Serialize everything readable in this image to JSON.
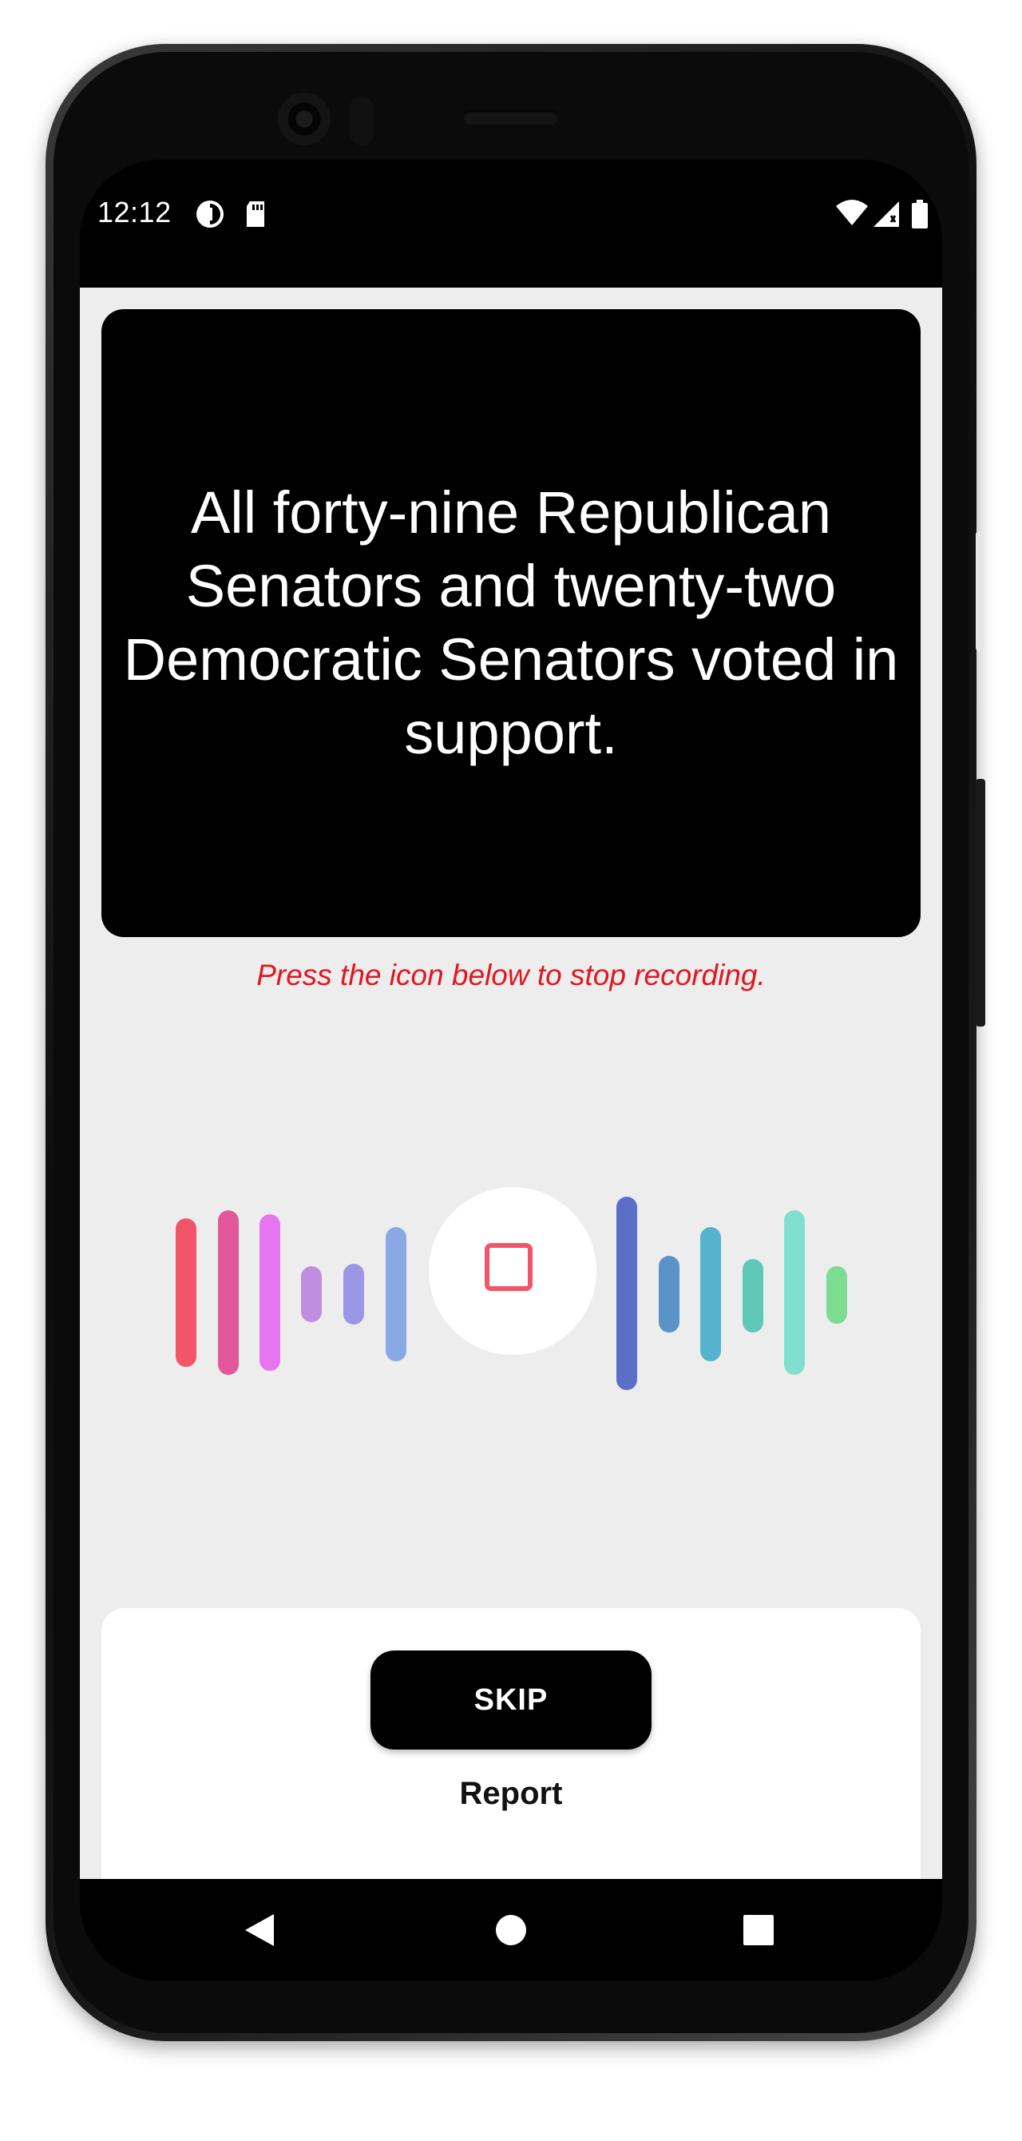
{
  "status_bar": {
    "time": "12:12",
    "icons_left": [
      "data-saver-icon",
      "sd-card-icon"
    ],
    "icons_right": [
      "wifi-icon",
      "cell-signal-icon",
      "battery-icon"
    ]
  },
  "prompt": {
    "sentence": "All forty-nine Republican Senators and twenty-two Democratic Senators voted in support."
  },
  "instruction": {
    "text": "Press the icon below to stop recording.",
    "color": "#e2161f"
  },
  "recorder": {
    "icon": "stop-icon",
    "state": "recording",
    "wave_colors_left": [
      "#f25568",
      "#e2589a",
      "#e576f0",
      "#bf8ee0",
      "#9b96e6",
      "#8aa8e4"
    ],
    "wave_colors_right": [
      "#5a6fc8",
      "#5a93c8",
      "#55b3cf",
      "#5fc9b5",
      "#7fe0cf",
      "#7bdc92"
    ]
  },
  "actions": {
    "skip_label": "SKIP",
    "report_label": "Report"
  },
  "nav": {
    "icons": [
      "back-icon",
      "home-icon",
      "recents-icon"
    ]
  }
}
